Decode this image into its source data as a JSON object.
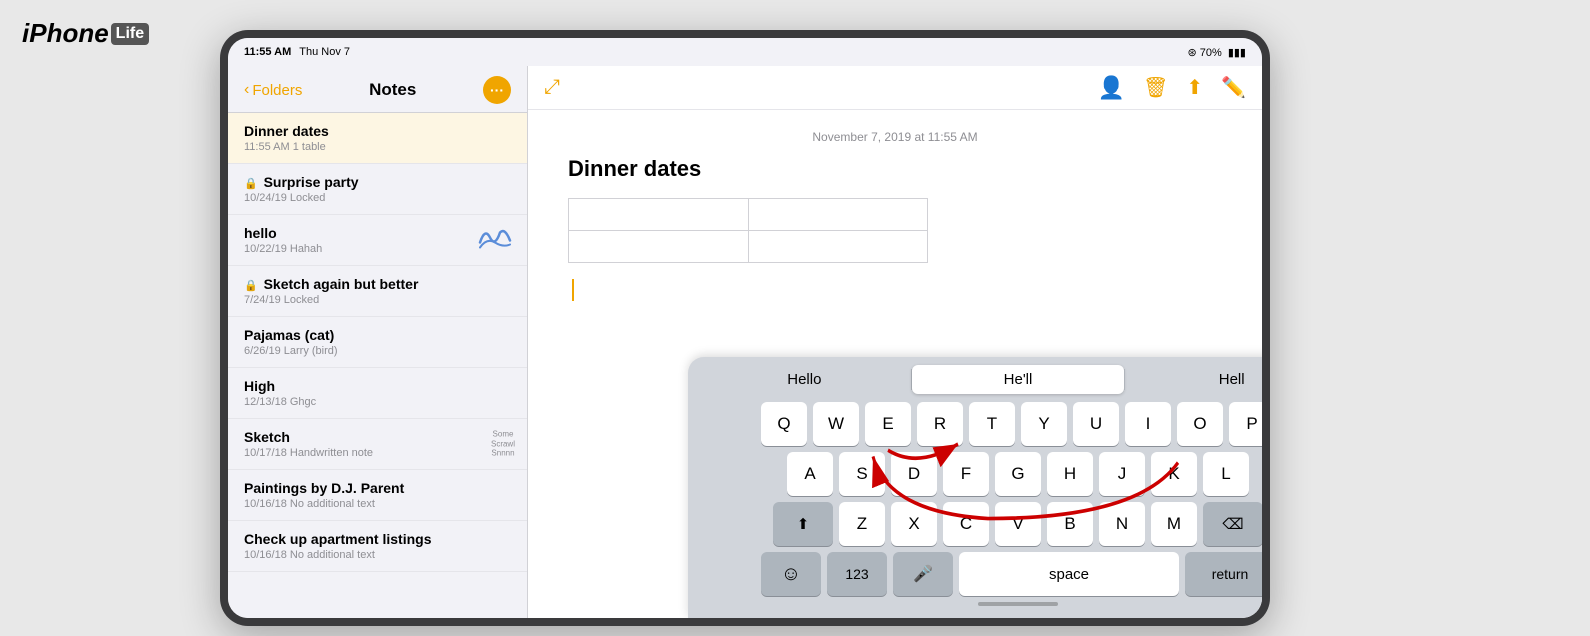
{
  "logo": {
    "iphone": "iPhone",
    "life": "Life"
  },
  "status_bar": {
    "time": "11:55 AM",
    "date": "Thu Nov 7",
    "wifi": "▾ 70%",
    "battery": "🔋"
  },
  "sidebar": {
    "back_label": "Folders",
    "title": "Notes",
    "more_icon": "•••",
    "notes": [
      {
        "title": "Dinner dates",
        "meta": "11:55 AM  1 table",
        "active": true,
        "locked": false,
        "has_sketch": false
      },
      {
        "title": "Surprise party",
        "meta": "10/24/19  Locked",
        "active": false,
        "locked": true,
        "has_sketch": false
      },
      {
        "title": "hello",
        "meta": "10/22/19  Hahah",
        "active": false,
        "locked": false,
        "has_sketch": true,
        "sketch_type": "scribble"
      },
      {
        "title": "Sketch again but better",
        "meta": "7/24/19  Locked",
        "active": false,
        "locked": true,
        "has_sketch": false
      },
      {
        "title": "Pajamas (cat)",
        "meta": "6/26/19  Larry (bird)",
        "active": false,
        "locked": false,
        "has_sketch": false
      },
      {
        "title": "High",
        "meta": "12/13/18  Ghgc",
        "active": false,
        "locked": false,
        "has_sketch": false
      },
      {
        "title": "Sketch",
        "meta": "10/17/18  Handwritten note",
        "active": false,
        "locked": false,
        "has_sketch": true,
        "sketch_type": "handwritten"
      },
      {
        "title": "Paintings by D.J. Parent",
        "meta": "10/16/18  No additional text",
        "active": false,
        "locked": false,
        "has_sketch": false
      },
      {
        "title": "Check up apartment listings",
        "meta": "10/16/18  No additional text",
        "active": false,
        "locked": false,
        "has_sketch": false
      }
    ]
  },
  "note": {
    "date": "November 7, 2019 at 11:55 AM",
    "title": "Dinner dates"
  },
  "keyboard": {
    "autocomplete": [
      "Hello",
      "He'll",
      "Hell"
    ],
    "autocomplete_selected_index": 1,
    "rows": [
      [
        "Q",
        "W",
        "E",
        "R",
        "T",
        "Y",
        "U",
        "I",
        "O",
        "P"
      ],
      [
        "A",
        "S",
        "D",
        "F",
        "G",
        "H",
        "J",
        "K",
        "L"
      ],
      [
        "⇧",
        "Z",
        "X",
        "C",
        "V",
        "B",
        "N",
        "M",
        "⌫"
      ],
      [
        "☺",
        "123",
        "🎤",
        "space",
        "return"
      ]
    ]
  },
  "toolbar": {
    "left_icon": "↗",
    "right_icons": [
      "person-circle",
      "trash",
      "share",
      "compose"
    ]
  }
}
